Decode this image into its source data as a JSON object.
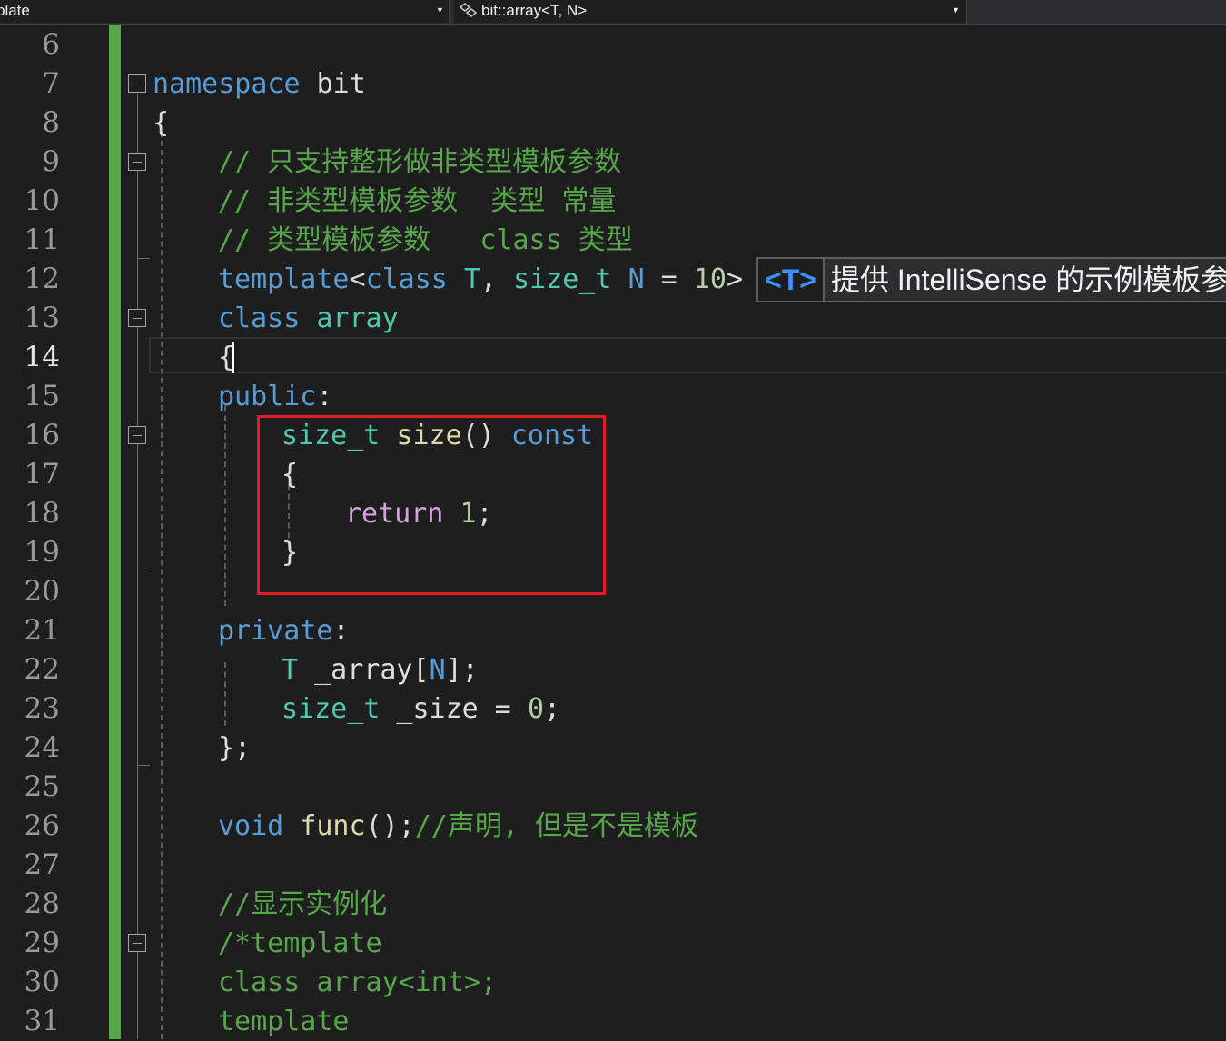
{
  "navbar": {
    "project_combo": "plate",
    "symbol_combo": "bit::array<T, N>"
  },
  "tooltip": {
    "tag": "<T>",
    "text": "提供 IntelliSense 的示例模板参"
  },
  "line_numbers": [
    "6",
    "7",
    "8",
    "9",
    "10",
    "11",
    "12",
    "13",
    "14",
    "15",
    "16",
    "17",
    "18",
    "19",
    "20",
    "21",
    "22",
    "23",
    "24",
    "25",
    "26",
    "27",
    "28",
    "29",
    "30",
    "31"
  ],
  "current_line": "14",
  "code": {
    "l7": [
      {
        "t": "namespace",
        "c": "kw"
      },
      {
        "t": " bit",
        "c": "plain"
      }
    ],
    "l8": [
      {
        "t": "{",
        "c": "plain"
      }
    ],
    "l9": [
      {
        "t": "// 只支持整形做非类型模板参数",
        "c": "cm"
      }
    ],
    "l10": [
      {
        "t": "// 非类型模板参数  类型 常量",
        "c": "cm"
      }
    ],
    "l11": [
      {
        "t": "// 类型模板参数   class 类型",
        "c": "cm"
      }
    ],
    "l12": [
      {
        "t": "template",
        "c": "kw"
      },
      {
        "t": "<",
        "c": "plain"
      },
      {
        "t": "class",
        "c": "kw"
      },
      {
        "t": " ",
        "c": "plain"
      },
      {
        "t": "T",
        "c": "ty"
      },
      {
        "t": ", ",
        "c": "plain"
      },
      {
        "t": "size_t",
        "c": "ty"
      },
      {
        "t": " ",
        "c": "plain"
      },
      {
        "t": "N",
        "c": "kw"
      },
      {
        "t": " = ",
        "c": "plain"
      },
      {
        "t": "10",
        "c": "num"
      },
      {
        "t": ">",
        "c": "plain"
      }
    ],
    "l13": [
      {
        "t": "class",
        "c": "kw"
      },
      {
        "t": " ",
        "c": "plain"
      },
      {
        "t": "array",
        "c": "ty"
      }
    ],
    "l14": [
      {
        "t": "{",
        "c": "plain"
      }
    ],
    "l15": [
      {
        "t": "public",
        "c": "kw"
      },
      {
        "t": ":",
        "c": "plain"
      }
    ],
    "l16": [
      {
        "t": "size_t",
        "c": "ty"
      },
      {
        "t": " ",
        "c": "plain"
      },
      {
        "t": "size",
        "c": "fn"
      },
      {
        "t": "() ",
        "c": "plain"
      },
      {
        "t": "const",
        "c": "kw"
      }
    ],
    "l17": [
      {
        "t": "{",
        "c": "plain"
      }
    ],
    "l18": [
      {
        "t": "return",
        "c": "ctl"
      },
      {
        "t": " ",
        "c": "plain"
      },
      {
        "t": "1",
        "c": "num"
      },
      {
        "t": ";",
        "c": "plain"
      }
    ],
    "l19": [
      {
        "t": "}",
        "c": "plain"
      }
    ],
    "l21": [
      {
        "t": "private",
        "c": "kw"
      },
      {
        "t": ":",
        "c": "plain"
      }
    ],
    "l22": [
      {
        "t": "T",
        "c": "ty"
      },
      {
        "t": " _array[",
        "c": "plain"
      },
      {
        "t": "N",
        "c": "kw"
      },
      {
        "t": "];",
        "c": "plain"
      }
    ],
    "l23": [
      {
        "t": "size_t",
        "c": "ty"
      },
      {
        "t": " _size = ",
        "c": "plain"
      },
      {
        "t": "0",
        "c": "num"
      },
      {
        "t": ";",
        "c": "plain"
      }
    ],
    "l24": [
      {
        "t": "};",
        "c": "plain"
      }
    ],
    "l26": [
      {
        "t": "void",
        "c": "kw"
      },
      {
        "t": " ",
        "c": "plain"
      },
      {
        "t": "func",
        "c": "fn"
      },
      {
        "t": "();",
        "c": "plain"
      },
      {
        "t": "//声明, 但是不是模板",
        "c": "cm"
      }
    ],
    "l28": [
      {
        "t": "//显示实例化",
        "c": "cm"
      }
    ],
    "l29": [
      {
        "t": "/*template",
        "c": "cm"
      }
    ],
    "l30": [
      {
        "t": "class array<int>;",
        "c": "cm"
      }
    ],
    "l31": [
      {
        "t": "template",
        "c": "cm"
      }
    ]
  },
  "colors": {
    "background": "#1e1e1e",
    "keyword": "#569cd6",
    "type": "#4ec9b0",
    "comment": "#57a64a",
    "function": "#dcdcaa",
    "control": "#d8a0df",
    "number": "#b5cea8",
    "change_bar": "#57a64a",
    "highlight_box": "#e51b23"
  }
}
